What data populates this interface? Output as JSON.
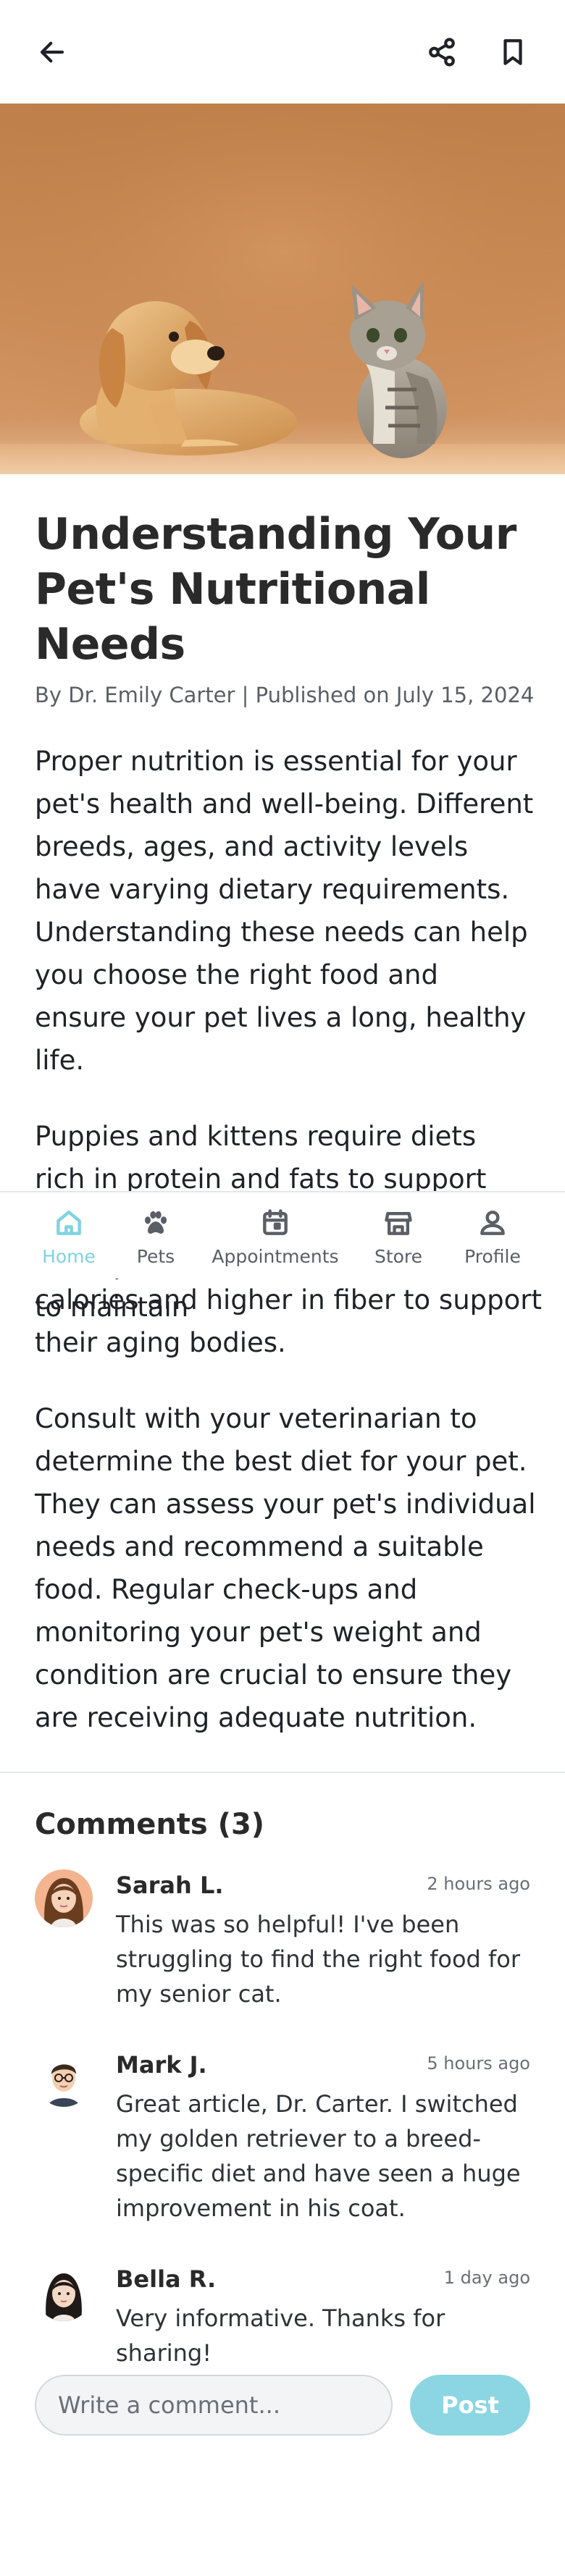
{
  "article": {
    "title": "Understanding Your Pet's Nutritional Needs",
    "byline": "By Dr. Emily Carter | Published on July 15, 2024",
    "paragraph_1": "Proper nutrition is essential for your pet's health and well-being. Different breeds, ages, and activity levels have varying dietary requirements. Understanding these needs can help you choose the right food and ensure your pet lives a long, healthy life.",
    "paragraph_2_visible_top": "Puppies and kittens require diets rich in protein and fats to support their rapid growth and development. Adult pets need balanced nutrition to maintain",
    "paragraph_2_visible_bottom": "calories and higher in fiber to support their aging bodies.",
    "paragraph_3": "Consult with your veterinarian to determine the best diet for your pet. They can assess your pet's individual needs and recommend a suitable food. Regular check-ups and monitoring your pet's weight and condition are crucial to ensure they are receiving adequate nutrition."
  },
  "topbar": {
    "back_icon": "arrow-left-icon",
    "share_icon": "share-icon",
    "bookmark_icon": "bookmark-icon"
  },
  "tabbar": {
    "active": "Home",
    "tabs": [
      {
        "label": "Home",
        "icon": "home-icon"
      },
      {
        "label": "Pets",
        "icon": "paw-icon"
      },
      {
        "label": "Appointments",
        "icon": "calendar-icon"
      },
      {
        "label": "Store",
        "icon": "store-icon"
      },
      {
        "label": "Profile",
        "icon": "person-icon"
      }
    ]
  },
  "comments": {
    "title": "Comments (3)",
    "items": [
      {
        "name": "Sarah L.",
        "time": "2 hours ago",
        "text": "This was so helpful! I've been struggling to find the right food for my senior cat."
      },
      {
        "name": "Mark J.",
        "time": "5 hours ago",
        "text": "Great article, Dr. Carter. I switched my golden retriever to a breed-specific diet and have seen a huge improvement in his coat."
      },
      {
        "name": "Bella R.",
        "time": "1 day ago",
        "text": "Very informative. Thanks for sharing!"
      }
    ]
  },
  "composer": {
    "placeholder": "Write a comment...",
    "post_label": "Post"
  },
  "colors": {
    "accent": "#7fd3e0",
    "post_button": "#8bd6e2",
    "text": "#1f2328",
    "muted": "#5a5f66"
  }
}
